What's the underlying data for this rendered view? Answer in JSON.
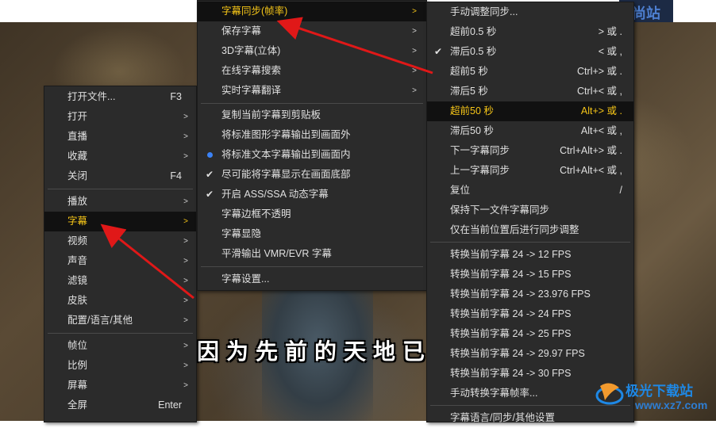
{
  "video": {
    "subtitle_text": "因为先前的天地已",
    "top_right_fragment": "尚站"
  },
  "menu_main": [
    {
      "label": "打开文件...",
      "shortcut": "F3"
    },
    {
      "label": "打开",
      "arrow": ">"
    },
    {
      "label": "直播",
      "arrow": ">"
    },
    {
      "label": "收藏",
      "arrow": ">"
    },
    {
      "label": "关闭",
      "shortcut": "F4"
    },
    {
      "label": "播放",
      "arrow": ">"
    },
    {
      "label": "字幕",
      "arrow": ">",
      "active": true
    },
    {
      "label": "视频",
      "arrow": ">"
    },
    {
      "label": "声音",
      "arrow": ">"
    },
    {
      "label": "滤镜",
      "arrow": ">"
    },
    {
      "label": "皮肤",
      "arrow": ">"
    },
    {
      "label": "配置/语言/其他",
      "arrow": ">"
    },
    {
      "label": "帧位",
      "arrow": ">"
    },
    {
      "label": "比例",
      "arrow": ">"
    },
    {
      "label": "屏幕",
      "arrow": ">"
    },
    {
      "label": "全屏",
      "shortcut": "Enter"
    }
  ],
  "menu_subtitle": [
    {
      "label": "字幕同步(帧率)",
      "arrow": ">",
      "active": true
    },
    {
      "label": "保存字幕",
      "arrow": ">"
    },
    {
      "label": "3D字幕(立体)",
      "arrow": ">"
    },
    {
      "label": "在线字幕搜索",
      "arrow": ">"
    },
    {
      "label": "实时字幕翻译",
      "arrow": ">"
    },
    {
      "label": "复制当前字幕到剪贴板"
    },
    {
      "label": "将标准图形字幕输出到画面外"
    },
    {
      "label": "将标准文本字幕输出到画面内",
      "mark": "dot"
    },
    {
      "label": "尽可能将字幕显示在画面底部",
      "mark": "check"
    },
    {
      "label": "开启 ASS/SSA 动态字幕",
      "mark": "check"
    },
    {
      "label": "字幕边框不透明"
    },
    {
      "label": "字幕显隐"
    },
    {
      "label": "平滑输出 VMR/EVR 字幕"
    },
    {
      "label": "字幕设置..."
    }
  ],
  "menu_sync": [
    {
      "label": "手动调整同步..."
    },
    {
      "label": "超前0.5 秒",
      "shortcut": "> 或 ."
    },
    {
      "label": "滞后0.5 秒",
      "shortcut": "< 或 ,",
      "mark": "check"
    },
    {
      "label": "超前5 秒",
      "shortcut": "Ctrl+> 或 ."
    },
    {
      "label": "滞后5 秒",
      "shortcut": "Ctrl+< 或 ,"
    },
    {
      "label": "超前50 秒",
      "shortcut": "Alt+> 或 .",
      "active": true
    },
    {
      "label": "滞后50 秒",
      "shortcut": "Alt+< 或 ,"
    },
    {
      "label": "下一字幕同步",
      "shortcut": "Ctrl+Alt+> 或 ."
    },
    {
      "label": "上一字幕同步",
      "shortcut": "Ctrl+Alt+< 或 ,"
    },
    {
      "label": "复位",
      "shortcut": "/"
    },
    {
      "label": "保持下一文件字幕同步"
    },
    {
      "label": "仅在当前位置后进行同步调整"
    },
    {
      "label": "转换当前字幕 24 -> 12 FPS"
    },
    {
      "label": "转换当前字幕 24 -> 15 FPS"
    },
    {
      "label": "转换当前字幕 24 -> 23.976 FPS"
    },
    {
      "label": "转换当前字幕 24 -> 24 FPS"
    },
    {
      "label": "转换当前字幕 24 -> 25 FPS"
    },
    {
      "label": "转换当前字幕 24 -> 29.97 FPS"
    },
    {
      "label": "转换当前字幕 24 -> 30 FPS"
    },
    {
      "label": "手动转换字幕帧率..."
    },
    {
      "label": "字幕语言/同步/其他设置"
    }
  ],
  "watermark": {
    "name": "极光下载站",
    "url": "www.xz7.com"
  },
  "colors": {
    "highlight": "#f5c518",
    "menu_bg": "#2b2b2b",
    "arrow_red": "#e01818",
    "radio_blue": "#3b82f6"
  }
}
